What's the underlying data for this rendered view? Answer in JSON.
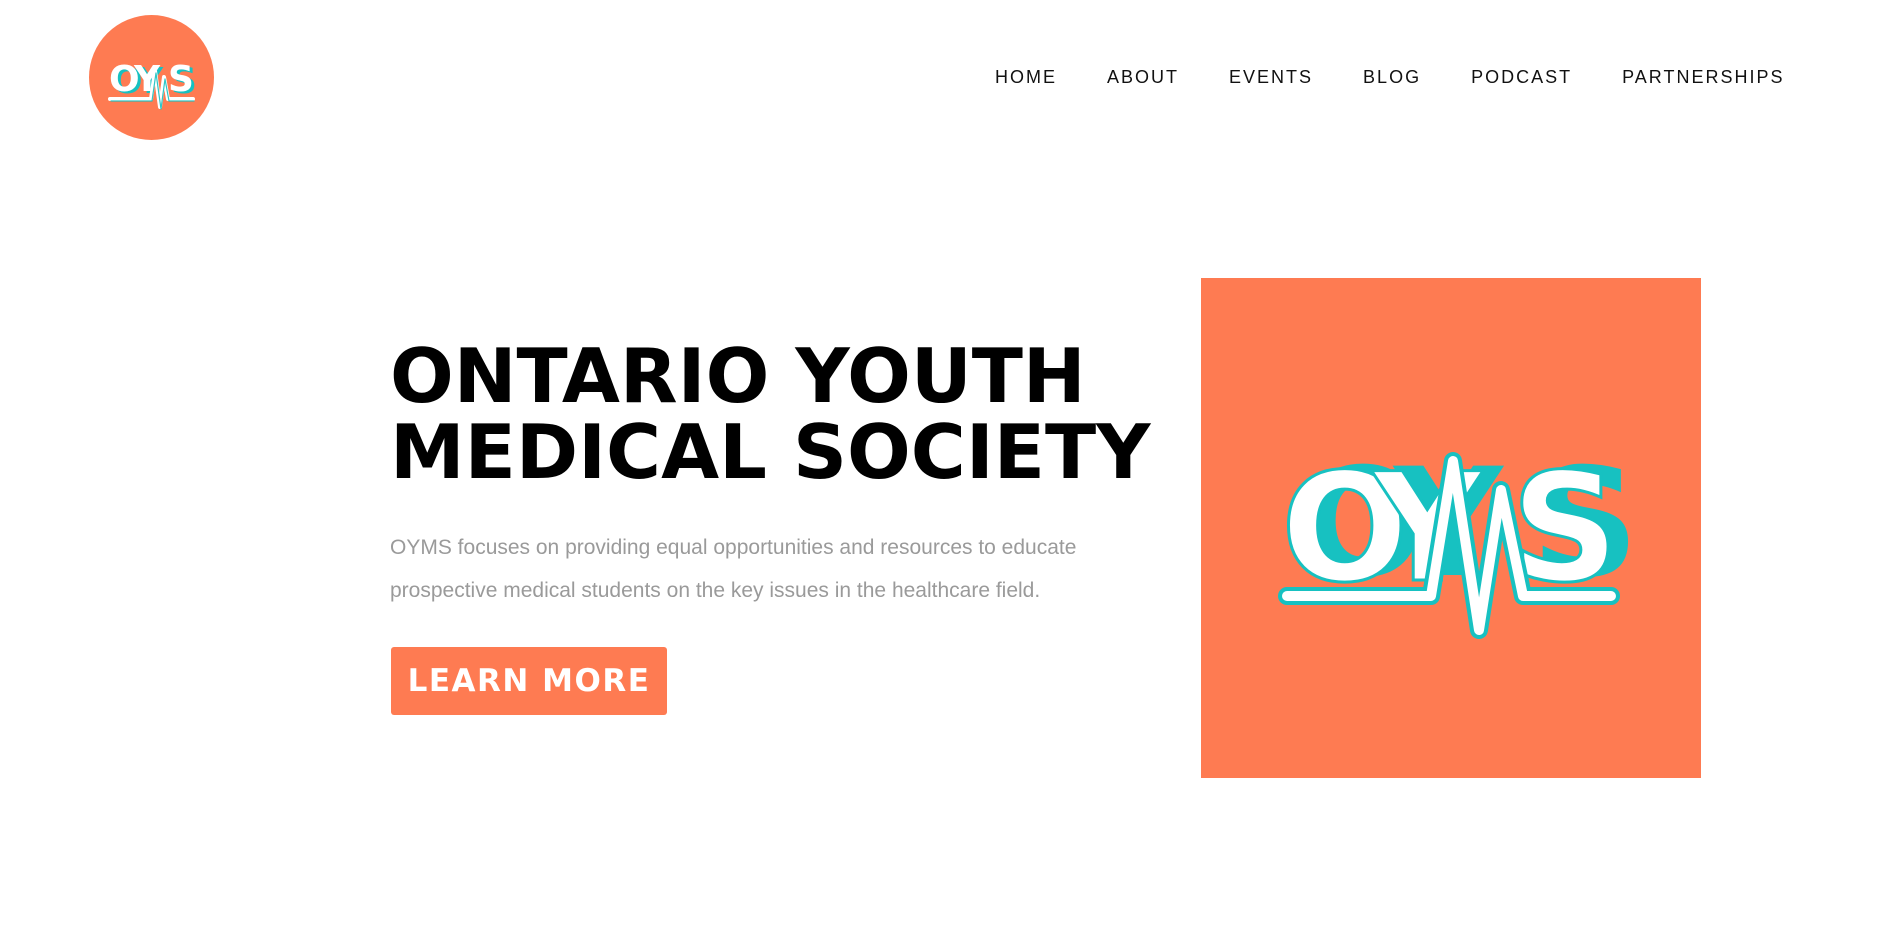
{
  "header": {
    "logo_text": "OYMS",
    "nav": [
      {
        "label": "HOME"
      },
      {
        "label": "ABOUT"
      },
      {
        "label": "EVENTS"
      },
      {
        "label": "BLOG"
      },
      {
        "label": "PODCAST"
      },
      {
        "label": "PARTNERSHIPS"
      }
    ]
  },
  "hero": {
    "title_line1": "ONTARIO YOUTH",
    "title_line2": "MEDICAL SOCIETY",
    "description": "OYMS focuses on providing equal opportunities and resources to educate prospective medical students on the key issues in the healthcare field.",
    "cta_label": "LEARN MORE",
    "image_logo_text": "OYMS"
  },
  "colors": {
    "brand_orange": "#fe7b52",
    "accent_teal": "#17c1c1",
    "title_black": "#000000",
    "body_gray": "#9a9a9a"
  },
  "icons": {
    "header_logo": "oyms-logo-icon",
    "hero_logo": "oyms-heartbeat-logo-icon"
  }
}
